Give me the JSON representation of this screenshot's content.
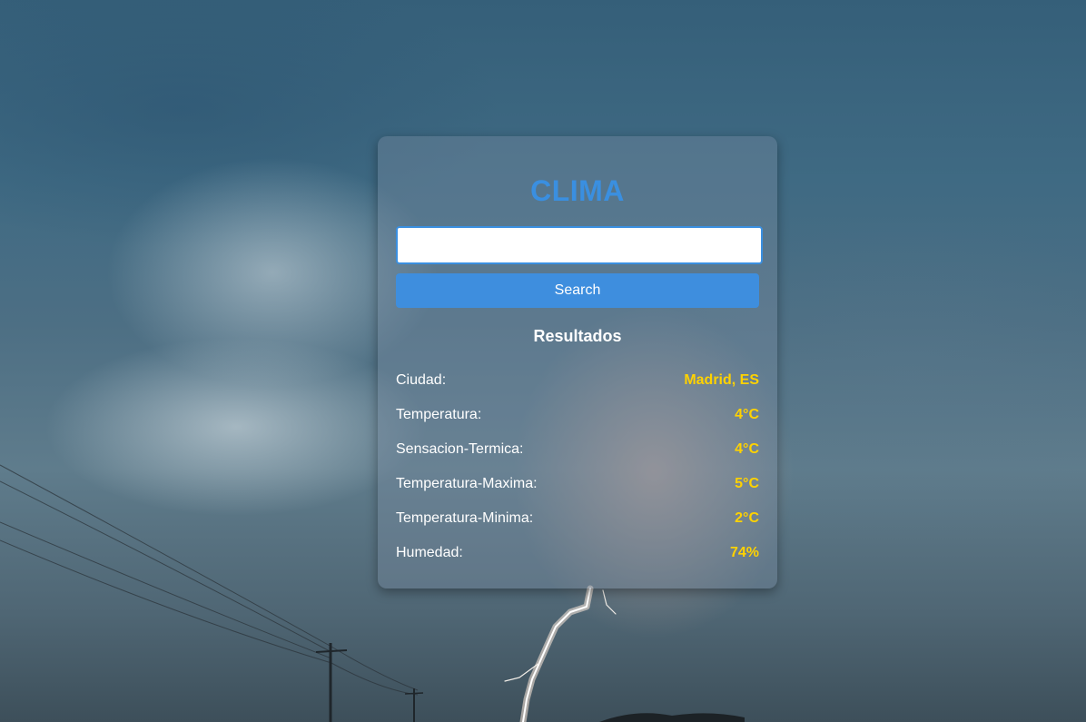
{
  "app": {
    "title": "CLIMA"
  },
  "search": {
    "value": "",
    "placeholder": "",
    "button_label": "Search"
  },
  "results": {
    "heading": "Resultados",
    "rows": [
      {
        "label": "Ciudad:",
        "value": "Madrid, ES"
      },
      {
        "label": "Temperatura:",
        "value": "4°C"
      },
      {
        "label": "Sensacion-Termica:",
        "value": "4°C"
      },
      {
        "label": "Temperatura-Maxima:",
        "value": "5°C"
      },
      {
        "label": "Temperatura-Minima:",
        "value": "2°C"
      },
      {
        "label": "Humedad:",
        "value": "74%"
      }
    ]
  },
  "colors": {
    "accent": "#3a8fe0",
    "value_highlight": "#ffd200",
    "text": "#ffffff"
  },
  "background": {
    "icon": "storm-lightning-photo"
  }
}
